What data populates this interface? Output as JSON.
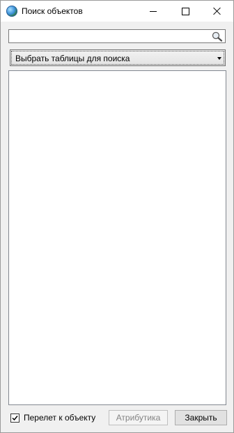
{
  "window": {
    "title": "Поиск объектов",
    "icon": "globe-icon"
  },
  "search": {
    "value": "",
    "placeholder": "",
    "icon": "search-icon"
  },
  "table_select": {
    "selected": "Выбрать таблицы для поиска",
    "icon": "chevron-down-icon"
  },
  "results": {
    "items": []
  },
  "footer": {
    "fly_to_object": {
      "label": "Перелет к объекту",
      "checked": true
    },
    "attributes_button": {
      "label": "Атрибутика",
      "enabled": false
    },
    "close_button": {
      "label": "Закрыть"
    }
  },
  "colors": {
    "window_background": "#f0f0f0",
    "titlebar_background": "#ffffff",
    "disabled_text": "#838383"
  }
}
